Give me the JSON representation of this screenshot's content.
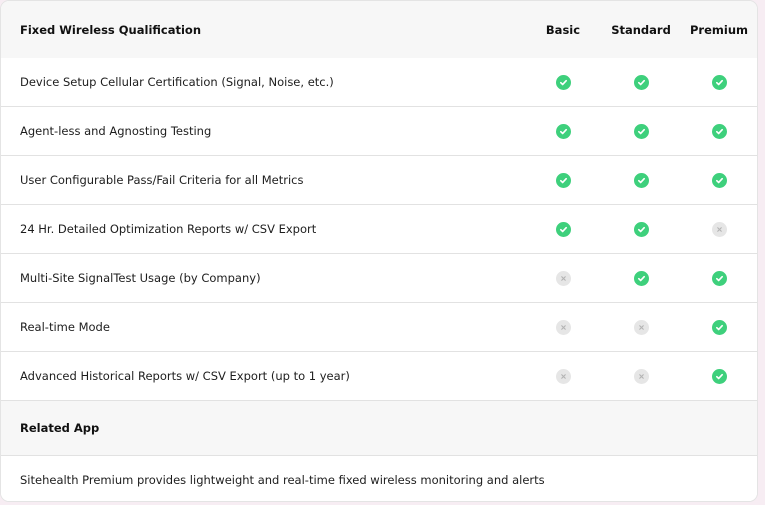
{
  "table": {
    "title": "Fixed Wireless Qualification",
    "columns": [
      "Basic",
      "Standard",
      "Premium"
    ],
    "icons": {
      "included": "check-circle-icon",
      "excluded": "x-circle-icon"
    },
    "colors": {
      "included": "#3ed07c",
      "excluded": "#e6e6e6",
      "header_bg": "#f7f7f7"
    },
    "features": [
      {
        "label": "Device Setup Cellular Certification (Signal, Noise, etc.)",
        "basic": true,
        "standard": true,
        "premium": true
      },
      {
        "label": "Agent-less and Agnosting Testing",
        "basic": true,
        "standard": true,
        "premium": true
      },
      {
        "label": "User Configurable Pass/Fail Criteria for all Metrics",
        "basic": true,
        "standard": true,
        "premium": true
      },
      {
        "label": "24 Hr. Detailed Optimization Reports w/ CSV Export",
        "basic": true,
        "standard": true,
        "premium": false
      },
      {
        "label": "Multi-Site SignalTest Usage (by Company)",
        "basic": false,
        "standard": true,
        "premium": true
      },
      {
        "label": "Real-time Mode",
        "basic": false,
        "standard": false,
        "premium": true
      },
      {
        "label": "Advanced Historical Reports w/ CSV Export (up to 1 year)",
        "basic": false,
        "standard": false,
        "premium": true
      }
    ]
  },
  "related": {
    "heading": "Related App",
    "description": "Sitehealth Premium provides lightweight and real-time fixed wireless monitoring and alerts"
  }
}
